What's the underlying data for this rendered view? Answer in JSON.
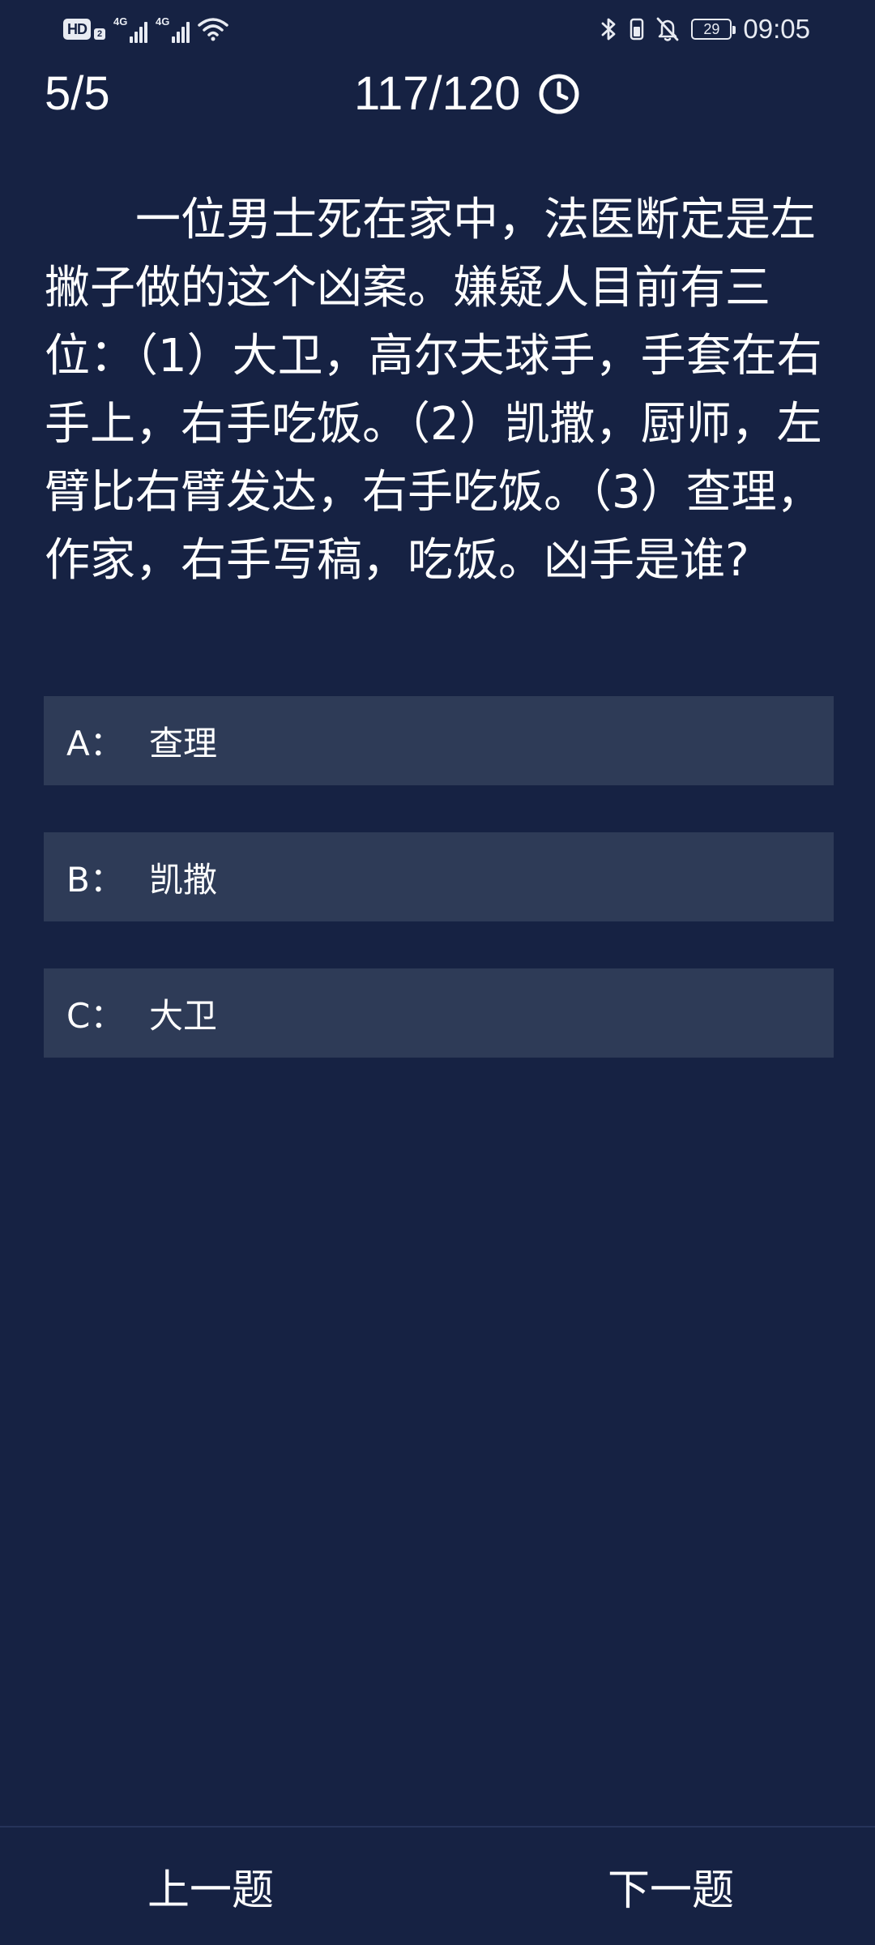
{
  "status_bar": {
    "hd_label": "HD",
    "hd_sub": "2",
    "network_tech_1": "4G",
    "network_tech_2": "4G",
    "battery_level": "29",
    "time": "09:05",
    "icons": [
      "bluetooth-icon",
      "vibrate-icon",
      "mute-bell-icon",
      "wifi-icon",
      "signal-icon"
    ]
  },
  "header": {
    "progress": "5/5",
    "timer": "117/120",
    "timer_icon": "clock-icon"
  },
  "question": {
    "text": "一位男士死在家中，法医断定是左撇子做的这个凶案。嫌疑人目前有三位：（1）大卫，高尔夫球手，手套在右手上，右手吃饭。（2）凯撒，厨师，左臂比右臂发达，右手吃饭。（3）查理，作家，右手写稿，吃饭。凶手是谁?"
  },
  "options": [
    {
      "key": "A：",
      "text": "查理"
    },
    {
      "key": "B：",
      "text": "凯撒"
    },
    {
      "key": "C：",
      "text": "大卫"
    }
  ],
  "nav": {
    "prev_label": "上一题",
    "next_label": "下一题"
  },
  "colors": {
    "background": "#162243",
    "option_background": "#2e3b57",
    "text": "#ffffff"
  }
}
